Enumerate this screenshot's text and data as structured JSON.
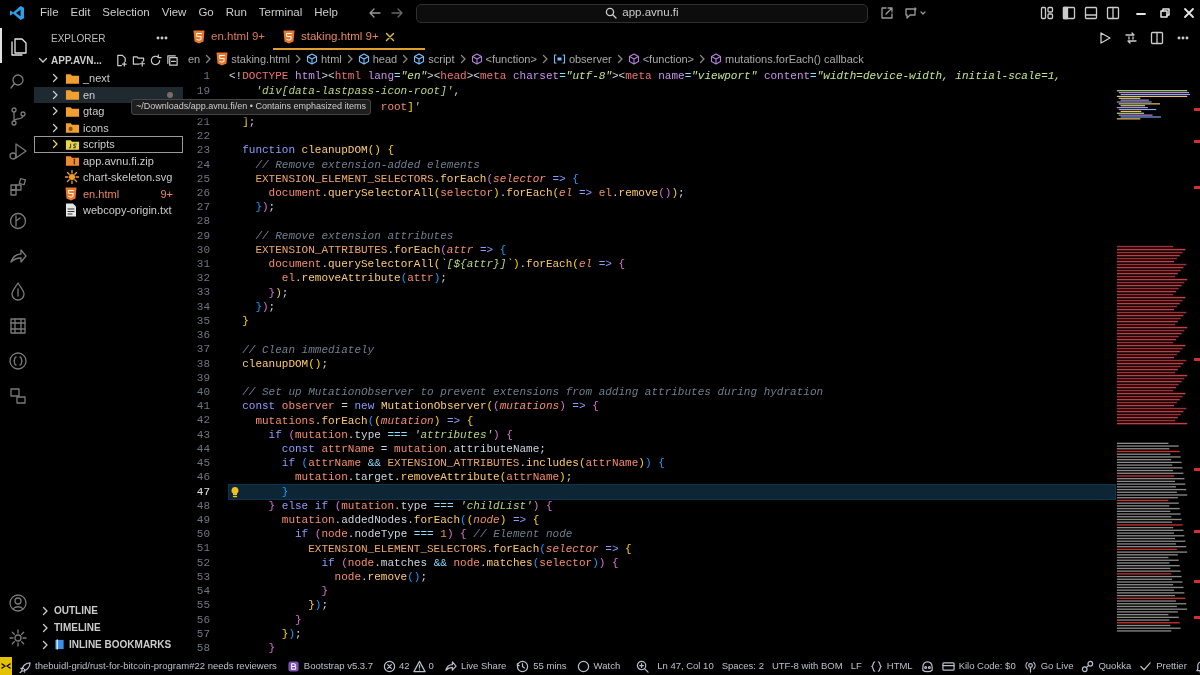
{
  "title_bar": {
    "menu": [
      "File",
      "Edit",
      "Selection",
      "View",
      "Go",
      "Run",
      "Terminal",
      "Help"
    ],
    "command_center": "app.avnu.fi"
  },
  "activity_bar": {
    "items": [
      {
        "kind": "explorer",
        "selected": true
      },
      {
        "kind": "search",
        "selected": false
      },
      {
        "kind": "scm",
        "selected": false
      },
      {
        "kind": "debug",
        "selected": false
      },
      {
        "kind": "extensions",
        "selected": false
      },
      {
        "kind": "gitlens",
        "selected": false
      },
      {
        "kind": "share",
        "selected": false
      },
      {
        "kind": "drop",
        "selected": false
      },
      {
        "kind": "grid",
        "selected": false
      },
      {
        "kind": "json",
        "selected": false
      },
      {
        "kind": "remote",
        "selected": false
      }
    ],
    "bottom": [
      {
        "kind": "account"
      },
      {
        "kind": "settings"
      }
    ]
  },
  "sidebar": {
    "title": "EXPLORER",
    "folder": "APP.AVN...",
    "items": [
      {
        "label": "_next",
        "kind": "folder",
        "hovered": false,
        "focused": false,
        "dot": false
      },
      {
        "label": "en",
        "kind": "folder",
        "hovered": true,
        "focused": false,
        "dot": true
      },
      {
        "label": "gtag",
        "kind": "folder",
        "hovered": false,
        "focused": false,
        "dot": false
      },
      {
        "label": "icons",
        "kind": "image-folder",
        "hovered": false,
        "focused": false,
        "dot": false
      },
      {
        "label": "scripts",
        "kind": "js-folder",
        "hovered": false,
        "focused": true,
        "dot": false
      },
      {
        "label": "app.avnu.fi.zip",
        "kind": "archive",
        "hovered": false,
        "focused": false,
        "dot": false
      },
      {
        "label": "chart-skeleton.svg",
        "kind": "svg",
        "hovered": false,
        "focused": false,
        "dot": false
      },
      {
        "label": "en.html",
        "kind": "html",
        "hovered": false,
        "focused": false,
        "dot": false,
        "badge": "9+"
      },
      {
        "label": "webcopy-origin.txt",
        "kind": "text",
        "hovered": false,
        "focused": false,
        "dot": false
      }
    ],
    "sections": [
      {
        "label": "OUTLINE",
        "kind": "plain"
      },
      {
        "label": "TIMELINE",
        "kind": "plain"
      },
      {
        "label": "INLINE BOOKMARKS",
        "kind": "bookmarks"
      }
    ],
    "tooltip": "~/Downloads/app.avnu.fi/en • Contains emphasized items"
  },
  "tabs": [
    {
      "label": "en.html",
      "badge": "9+",
      "selected": false
    },
    {
      "label": "staking.html",
      "badge": "9+",
      "selected": true
    }
  ],
  "breadcrumbs": [
    {
      "label": "en",
      "kind": "folder"
    },
    {
      "label": "staking.html",
      "kind": "html"
    },
    {
      "label": "html",
      "kind": "element"
    },
    {
      "label": "head",
      "kind": "element"
    },
    {
      "label": "script",
      "kind": "element"
    },
    {
      "label": "<function>",
      "kind": "function"
    },
    {
      "label": "observer",
      "kind": "variable"
    },
    {
      "label": "<function>",
      "kind": "function"
    },
    {
      "label": "mutations.forEach() callback",
      "kind": "function"
    }
  ],
  "sticky_lines": [
    {
      "number": "1",
      "kind": "html",
      "text": "<!DOCTYPE html><html lang=\"en\"><head><meta charset=\"utf-8\"><meta name=\"viewport\" content=\"width=device-width, initial-scale=1,"
    },
    {
      "number": "19",
      "kind": "js",
      "text": "    'div[data-lastpass-icon-root]',"
    },
    {
      "kind": "js",
      "text": "                       root]'"
    }
  ],
  "lines": [
    {
      "number": "21",
      "text": "  ];",
      "current": false
    },
    {
      "number": "22",
      "current": false
    },
    {
      "number": "23",
      "text": "  function cleanupDOM() {",
      "current": false
    },
    {
      "number": "24",
      "text": "    // Remove extension-added elements",
      "current": false
    },
    {
      "number": "25",
      "text": "    EXTENSION_ELEMENT_SELECTORS.forEach(selector => {",
      "current": false
    },
    {
      "number": "26",
      "text": "      document.querySelectorAll(selector).forEach(el => el.remove());",
      "current": false
    },
    {
      "number": "27",
      "text": "    });",
      "current": false
    },
    {
      "number": "28",
      "current": false
    },
    {
      "number": "29",
      "text": "    // Remove extension attributes",
      "current": false
    },
    {
      "number": "30",
      "text": "    EXTENSION_ATTRIBUTES.forEach(attr => {",
      "current": false
    },
    {
      "number": "31",
      "text": "      document.querySelectorAll(`[${attr}]`).forEach(el => {",
      "current": false
    },
    {
      "number": "32",
      "text": "        el.removeAttribute(attr);",
      "current": false
    },
    {
      "number": "33",
      "text": "      });",
      "current": false
    },
    {
      "number": "34",
      "text": "    });",
      "current": false
    },
    {
      "number": "35",
      "text": "  }",
      "current": false
    },
    {
      "number": "36",
      "current": false
    },
    {
      "number": "37",
      "text": "  // Clean immediately",
      "current": false
    },
    {
      "number": "38",
      "text": "  cleanupDOM();",
      "current": false
    },
    {
      "number": "39",
      "current": false
    },
    {
      "number": "40",
      "text": "  // Set up MutationObserver to prevent extensions from adding attributes during hydration",
      "current": false
    },
    {
      "number": "41",
      "text": "  const observer = new MutationObserver((mutations) => {",
      "current": false
    },
    {
      "number": "42",
      "text": "    mutations.forEach((mutation) => {",
      "current": false
    },
    {
      "number": "43",
      "text": "      if (mutation.type === 'attributes') {",
      "current": false
    },
    {
      "number": "44",
      "text": "        const attrName = mutation.attributeName;",
      "current": false
    },
    {
      "number": "45",
      "text": "        if (attrName && EXTENSION_ATTRIBUTES.includes(attrName)) {",
      "current": false
    },
    {
      "number": "46",
      "text": "          mutation.target.removeAttribute(attrName);",
      "current": false
    },
    {
      "number": "47",
      "text": "        }",
      "current": true
    },
    {
      "number": "48",
      "text": "      } else if (mutation.type === 'childList') {",
      "current": false
    },
    {
      "number": "49",
      "text": "        mutation.addedNodes.forEach((node) => {",
      "current": false
    },
    {
      "number": "50",
      "text": "          if (node.nodeType === 1) { // Element node",
      "current": false
    },
    {
      "number": "51",
      "text": "            EXTENSION_ELEMENT_SELECTORS.forEach(selector => {",
      "current": false
    },
    {
      "number": "52",
      "text": "              if (node.matches && node.matches(selector)) {",
      "current": false
    },
    {
      "number": "53",
      "text": "                node.remove();",
      "current": false
    },
    {
      "number": "54",
      "text": "              }",
      "current": false
    },
    {
      "number": "55",
      "text": "            });",
      "current": false
    },
    {
      "number": "56",
      "text": "          }",
      "current": false
    },
    {
      "number": "57",
      "text": "        });",
      "current": false
    },
    {
      "number": "58",
      "text": "      }",
      "current": false
    }
  ],
  "status_bar": {
    "left": [
      {
        "kind": "pr",
        "text": "thebuidl-grid/rust-for-bitcoin-program#22 needs reviewers"
      },
      {
        "kind": "bootstrap",
        "text": "Bootstrap v5.3.7"
      },
      {
        "kind": "problems",
        "errors": "42",
        "warnings": "0"
      },
      {
        "kind": "liveshare",
        "text": "Live Share"
      },
      {
        "kind": "clock",
        "text": "55 mins"
      },
      {
        "kind": "watch",
        "text": "Watch"
      }
    ],
    "right": [
      {
        "kind": "zoom"
      },
      {
        "kind": "plain",
        "text": "Ln 47, Col 10"
      },
      {
        "kind": "plain",
        "text": "Spaces: 2"
      },
      {
        "kind": "plain",
        "text": "UTF-8 with BOM"
      },
      {
        "kind": "plain",
        "text": "LF"
      },
      {
        "kind": "language",
        "text": "HTML"
      },
      {
        "kind": "copilot"
      },
      {
        "kind": "kilo",
        "text": "Kilo Code: $0"
      },
      {
        "kind": "golive",
        "text": "Go Live"
      },
      {
        "kind": "quokka",
        "text": "Quokka"
      },
      {
        "kind": "prettier",
        "text": "Prettier"
      },
      {
        "kind": "bell"
      }
    ]
  }
}
